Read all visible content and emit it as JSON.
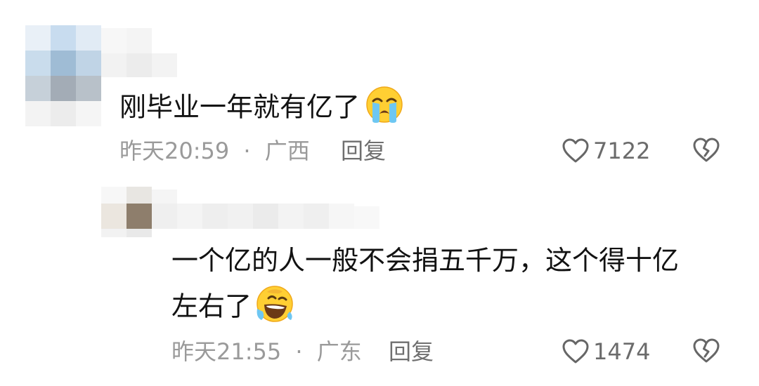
{
  "comments": [
    {
      "text": "刚毕业一年就有亿了",
      "emoji": "crying-face",
      "time": "昨天20:59",
      "separator": "·",
      "location": "广西",
      "reply_label": "回复",
      "likes": "7122"
    },
    {
      "line1": "一个亿的人一般不会捐五千万，这个得十亿",
      "line2": "左右了",
      "emoji": "rolling-laughing-face",
      "time": "昨天21:55",
      "separator": "·",
      "location": "广东",
      "reply_label": "回复",
      "likes": "1474"
    }
  ],
  "icons": {
    "like": "heart-outline-icon",
    "dislike": "broken-heart-icon"
  }
}
